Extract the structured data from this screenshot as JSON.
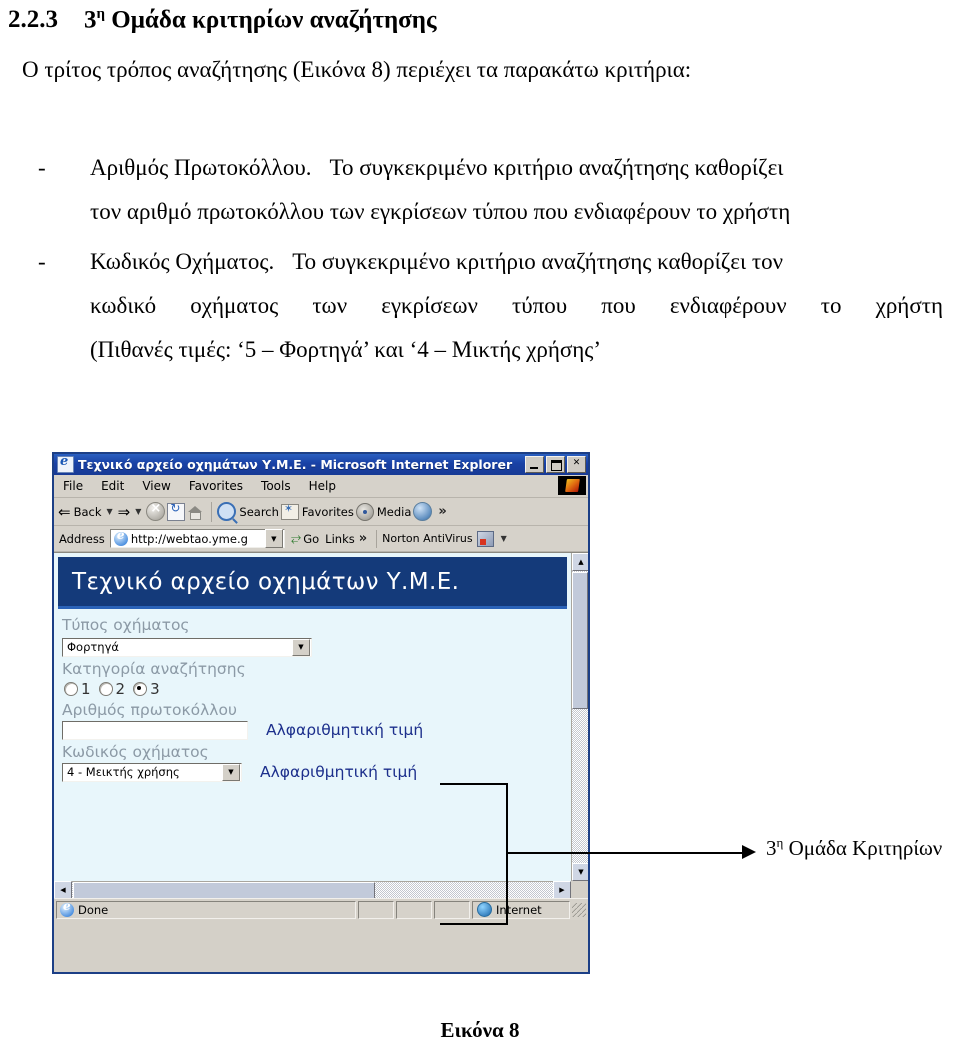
{
  "document": {
    "heading": {
      "number": "2.2.3",
      "ordinal_base": "3",
      "ordinal_sup": "η",
      "text": "Ομάδα κριτηρίων αναζήτησης"
    },
    "intro": "Ο τρίτος τρόπος αναζήτησης (Εικόνα 8) περιέχει τα παρακάτω κριτήρια:",
    "bullets": [
      {
        "marker": "-",
        "lead": "Αριθμός Πρωτοκόλλου.",
        "line1": "Το συγκεκριμένο κριτήριο αναζήτησης καθορίζει",
        "line2": "τον αριθμό πρωτοκόλλου των εγκρίσεων τύπου που ενδιαφέρουν το χρήστη"
      },
      {
        "marker": "-",
        "lead": "Κωδικός Οχήματος.",
        "line1": "Το συγκεκριμένο κριτήριο αναζήτησης καθορίζει τον",
        "line2": "κωδικό οχήματος των εγκρίσεων τύπου που ενδιαφέρουν το χρήστη",
        "line3": "(Πιθανές τιμές: ‘5 – Φορτηγά’ και ‘4 – Μικτής χρήσης’"
      }
    ],
    "caption": "Εικόνα 8"
  },
  "callout": {
    "label_base": "3",
    "label_sup": "η",
    "label_text": " Ομάδα Κριτηρίων"
  },
  "browser": {
    "title": "Τεχνικό αρχείο οχημάτων Υ.Μ.Ε. - Microsoft Internet Explorer",
    "window_buttons": [
      {
        "name": "minimize",
        "glyph": ""
      },
      {
        "name": "maximize",
        "glyph": ""
      },
      {
        "name": "close",
        "glyph": "✕"
      }
    ],
    "menu": [
      "File",
      "Edit",
      "View",
      "Favorites",
      "Tools",
      "Help"
    ],
    "toolbar": {
      "back": "Back",
      "search": "Search",
      "favorites": "Favorites",
      "media": "Media",
      "overflow": "»"
    },
    "address": {
      "label": "Address",
      "value": "http://webtao.yme.g",
      "go": "Go",
      "links": "Links",
      "links_overflow": "»",
      "antivirus": "Norton AntiVirus"
    },
    "status": {
      "done": "Done",
      "zone": "Internet"
    }
  },
  "page": {
    "header_title": "Τεχνικό αρχείο οχημάτων Υ.Μ.Ε.",
    "fields": {
      "vehicle_type_label": "Τύπος οχήματος",
      "vehicle_type_value": "Φορτηγά",
      "search_category_label": "Κατηγορία αναζήτησης",
      "search_category_options": [
        "1",
        "2",
        "3"
      ],
      "search_category_selected": "3",
      "protocol_label": "Αριθμός πρωτοκόλλου",
      "protocol_value": "",
      "protocol_hint": "Αλφαριθμητική τιμή",
      "vehicle_code_label": "Κωδικός οχήματος",
      "vehicle_code_value": "4 - Μεικτής χρήσης",
      "vehicle_code_hint": "Αλφαριθμητική τιμή"
    }
  },
  "colors": {
    "titlebar": "#173a95",
    "page_header": "#143a7a",
    "page_bg": "#e8f6fb",
    "hint_text": "#1c2f8c",
    "label_text": "#8c9aa6",
    "chrome": "#d6d2ca"
  }
}
